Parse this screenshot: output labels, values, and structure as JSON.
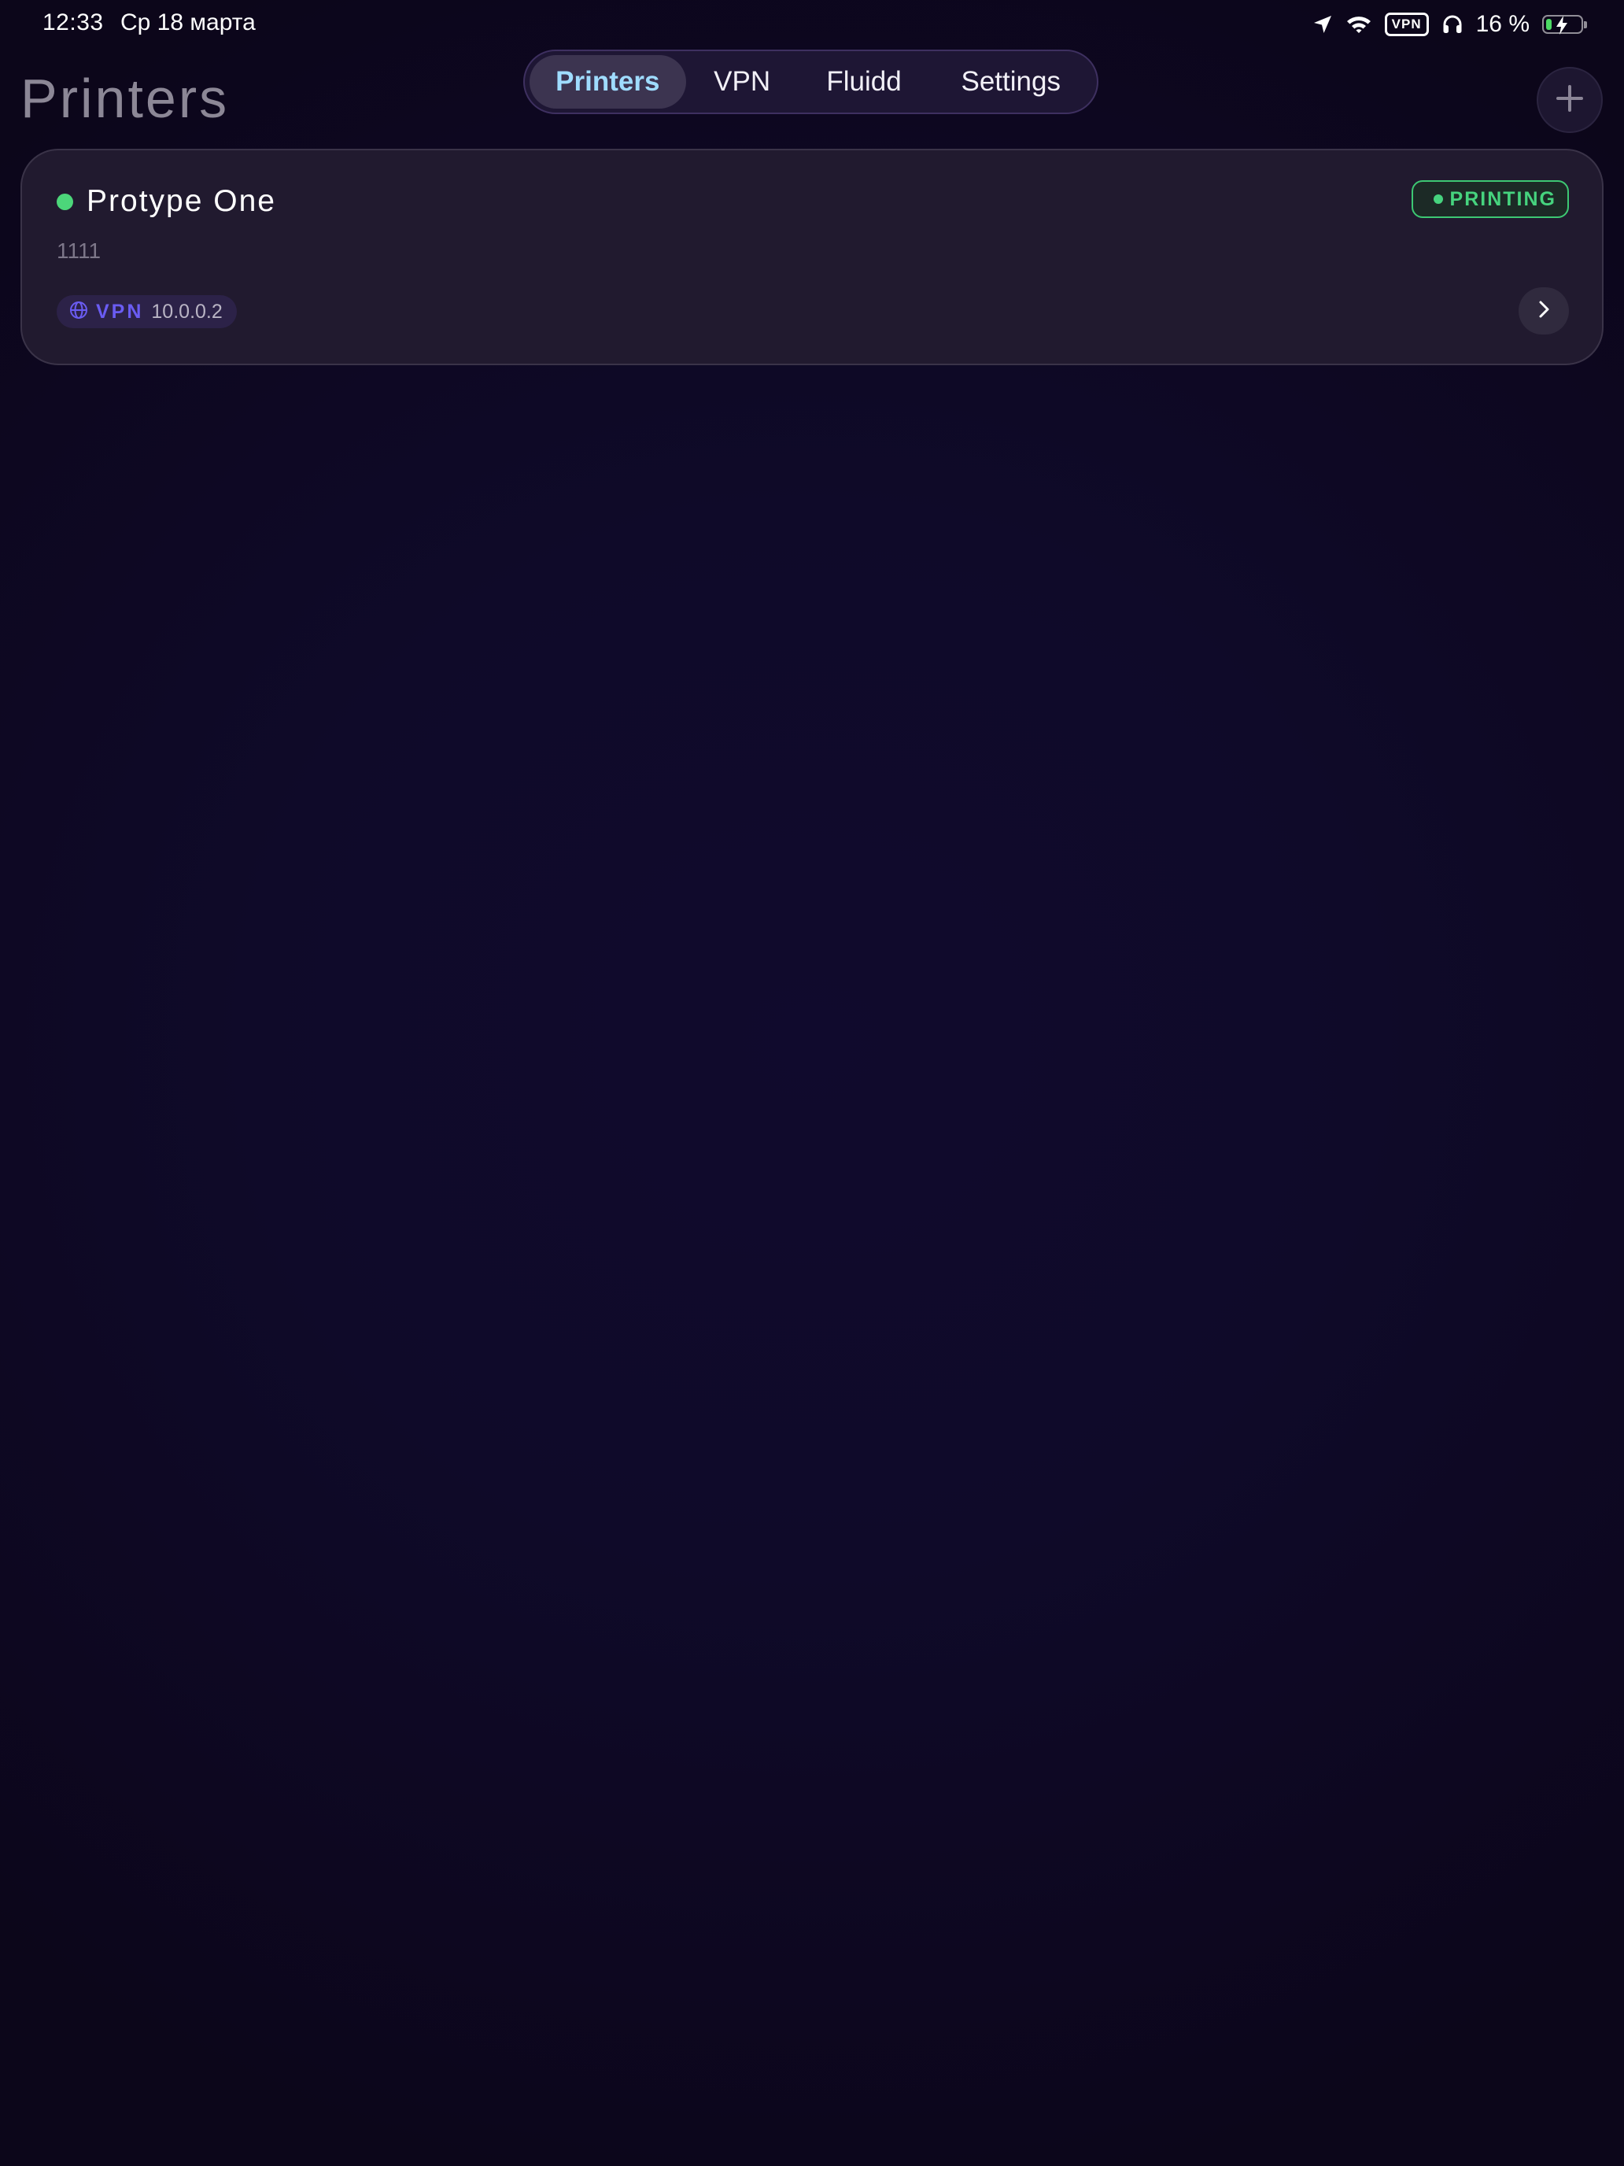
{
  "status_bar": {
    "time": "12:33",
    "date": "Ср 18 марта",
    "vpn_indicator": "VPN",
    "battery_percent": "16 %",
    "battery_level": 0.16,
    "battery_charging": true,
    "icons": [
      "location-arrow-icon",
      "wifi-icon",
      "headphones-icon",
      "battery-icon"
    ]
  },
  "header": {
    "title": "Printers",
    "add_icon": "plus-icon"
  },
  "tabs": [
    {
      "label": "Printers",
      "active": true
    },
    {
      "label": "VPN",
      "active": false
    },
    {
      "label": "Fluidd",
      "active": false
    },
    {
      "label": "Settings",
      "active": false
    }
  ],
  "printers": [
    {
      "name": "Protype One",
      "subtitle": "1111",
      "status": "PRINTING",
      "online": true,
      "network_label": "VPN",
      "ip": "10.0.0.2",
      "network_icon": "globe-icon",
      "open_icon": "chevron-right-icon"
    }
  ],
  "colors": {
    "accent_active_tab": "#9fdcff",
    "status_green": "#46d37e",
    "vpn_purple": "#6a5cf2",
    "card_bg": "#211a2f",
    "page_bg": "#0f0a29"
  }
}
